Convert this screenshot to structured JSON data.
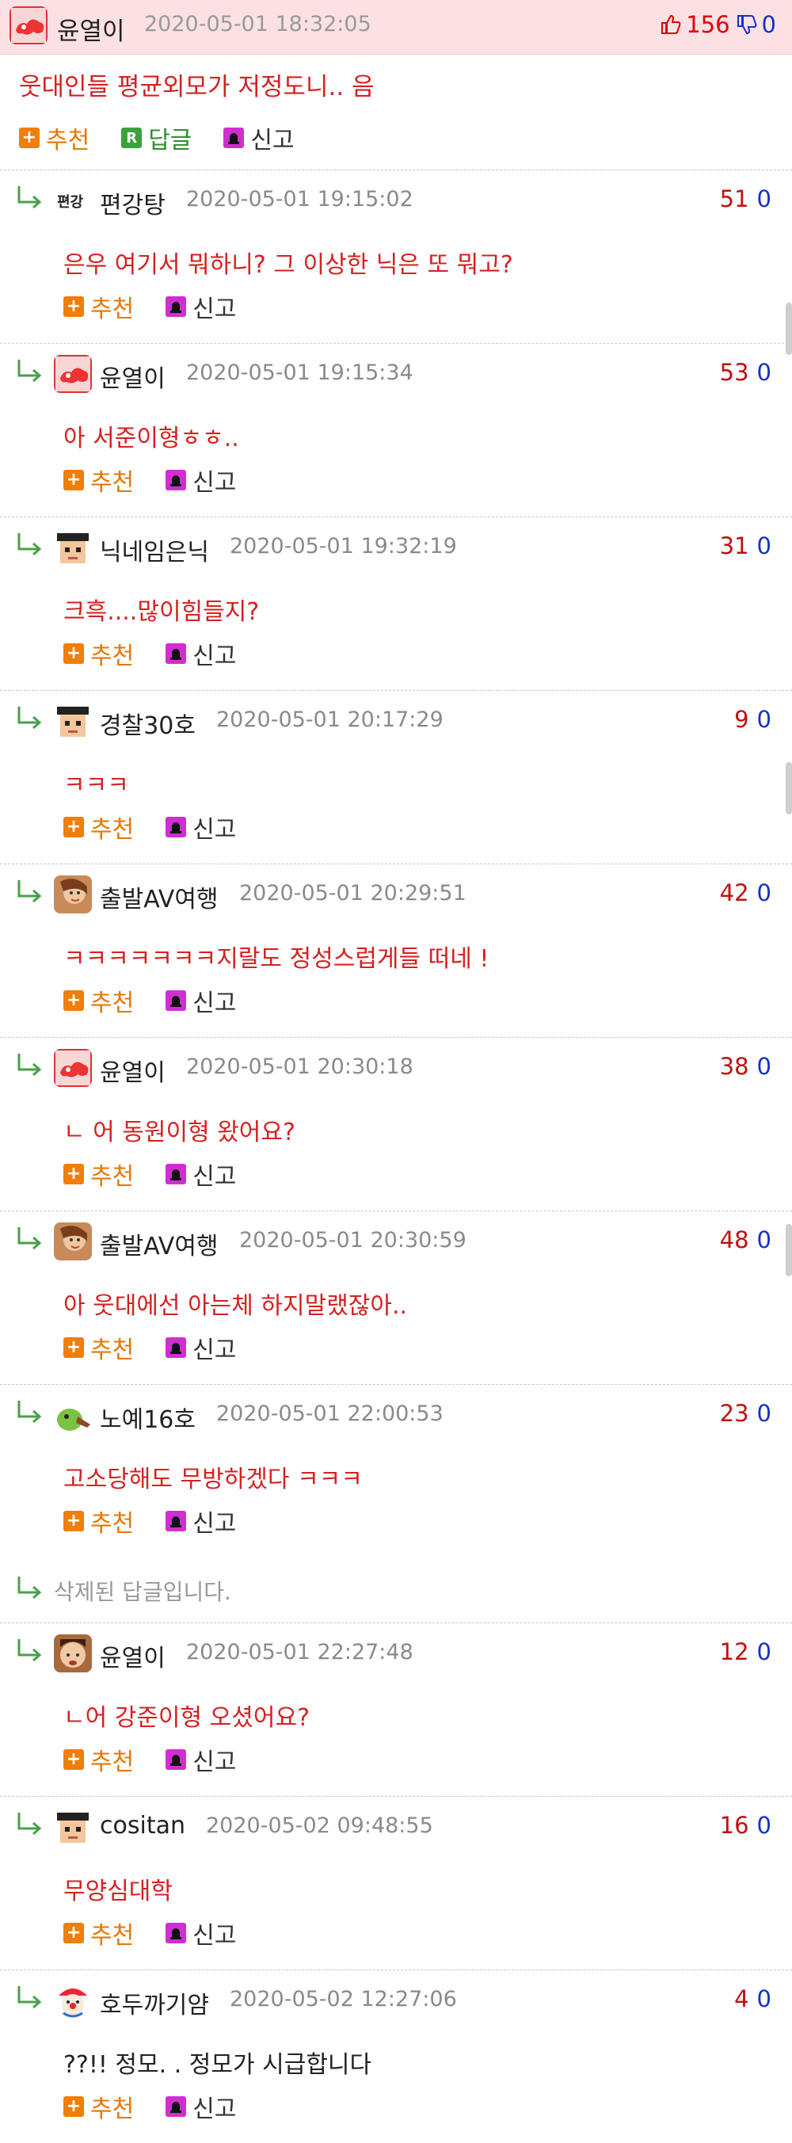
{
  "parent": {
    "nick": "윤열이",
    "date": "2020-05-01 18:32:05",
    "up_votes": "156",
    "down_votes": "0",
    "text": "웃대인들 평균외모가 저정도니.. 음",
    "actions": {
      "recommend": "추천",
      "reply": "답글",
      "report": "신고"
    }
  },
  "replies": [
    {
      "nick": "편강탕",
      "date": "2020-05-01 19:15:02",
      "up": "51",
      "down": "0",
      "text": "은우 여기서 뭐하니? 그 이상한 닉은 또 뭐고?",
      "avatar": "text-logo-icon"
    },
    {
      "nick": "윤열이",
      "date": "2020-05-01 19:15:34",
      "up": "53",
      "down": "0",
      "text": "아 서준이형ㅎㅎ..",
      "avatar": "red-cloud-icon"
    },
    {
      "nick": "닉네임은닉",
      "date": "2020-05-01 19:32:19",
      "up": "31",
      "down": "0",
      "text": "크흑....많이힘들지?",
      "avatar": "pixel-face-icon"
    },
    {
      "nick": "경찰30호",
      "date": "2020-05-01 20:17:29",
      "up": "9",
      "down": "0",
      "text": "ㅋㅋㅋ",
      "avatar": "pixel-face-icon"
    },
    {
      "nick": "출발AV여행",
      "date": "2020-05-01 20:29:51",
      "up": "42",
      "down": "0",
      "text": "ㅋㅋㅋㅋㅋㅋㅋ지랄도 정성스럽게들 떠네 !",
      "avatar": "photo-avatar-icon"
    },
    {
      "nick": "윤열이",
      "date": "2020-05-01 20:30:18",
      "up": "38",
      "down": "0",
      "text": "ㄴ 어 동원이형 왔어요?",
      "avatar": "red-cloud-icon"
    },
    {
      "nick": "출발AV여행",
      "date": "2020-05-01 20:30:59",
      "up": "48",
      "down": "0",
      "text": "아 웃대에선 아는체 하지말랬잖아..",
      "avatar": "photo-avatar-icon"
    },
    {
      "nick": "노예16호",
      "date": "2020-05-01 22:00:53",
      "up": "23",
      "down": "0",
      "text": "고소당해도 무방하겠다 ㅋㅋㅋ",
      "avatar": "green-creature-icon"
    }
  ],
  "deleted_text": "삭제된 답글입니다.",
  "replies2": [
    {
      "nick": "윤열이",
      "date": "2020-05-01 22:27:48",
      "up": "12",
      "down": "0",
      "text": "ㄴ어 강준이형 오셨어요?",
      "avatar": "face-photo-icon"
    },
    {
      "nick": "cositan",
      "date": "2020-05-02 09:48:55",
      "up": "16",
      "down": "0",
      "text": "무양심대학",
      "avatar": "pixel-face-icon"
    },
    {
      "nick": "호두까기얌",
      "date": "2020-05-02 12:27:06",
      "up": "4",
      "down": "0",
      "text": "??!! 정모. . 정모가 시급합니다",
      "avatar": "clown-icon"
    }
  ],
  "action_labels": {
    "recommend": "추천",
    "report": "신고"
  },
  "colors": {
    "header_bg": "#fce1e4",
    "comment_red": "#d62020",
    "vote_up": "#c01010",
    "vote_down": "#1730c7",
    "recommend_orange": "#f07e08"
  }
}
